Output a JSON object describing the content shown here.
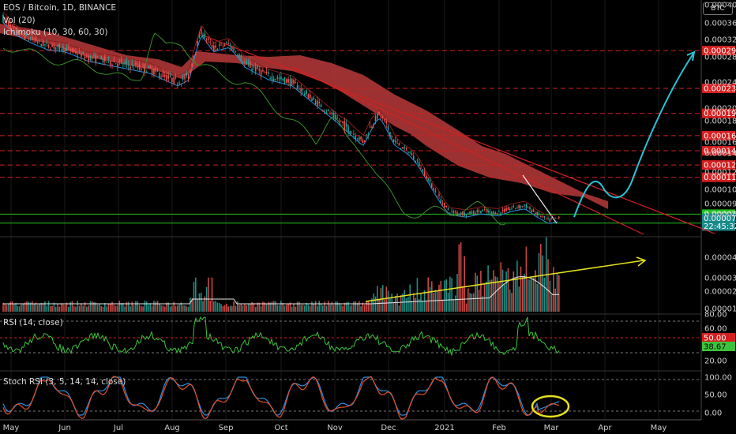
{
  "header": {
    "title": "EOS / Bitcoin, 1D, BINANCE",
    "vol_label": "Vol (20)",
    "ichimoku_label": "Ichimoku (10, 30, 60, 30)",
    "rsi_label": "RSI (14, close)",
    "stoch_label": "Stoch RSI (3, 5, 14, 14, close)",
    "currency_badge": "BTC"
  },
  "price_axis": {
    "ticks": [
      "0.0004000",
      "0.0003600",
      "0.0003200",
      "0.0002800",
      "0.0002400",
      "0.0002000",
      "0.0001800",
      "0.0001600",
      "0.0001400",
      "0.0001200",
      "0.0001000",
      "0.0000900",
      "0.0000800"
    ],
    "ylim": [
      7e-05,
      0.0004
    ]
  },
  "levels": [
    {
      "value": "0.0002944",
      "color": "#d42020"
    },
    {
      "value": "0.0002303",
      "color": "#d42020"
    },
    {
      "value": "0.0001916",
      "color": "#d42020"
    },
    {
      "value": "0.0001660",
      "color": "#d42020"
    },
    {
      "value": "0.0001442",
      "color": "#d42020"
    },
    {
      "value": "0.0001274",
      "color": "#d42020"
    },
    {
      "value": "0.0001139",
      "color": "#d42020"
    },
    {
      "value": "0.0000797",
      "color": "#1fc41f"
    },
    {
      "value": "0.0000716",
      "color": "#1fc41f"
    }
  ],
  "last_price": {
    "value": "0.0000761",
    "countdown": "22:45:32"
  },
  "volume_axis": {
    "ticks": [
      "0.0000450",
      "0.0000330",
      "0.0000230",
      "0.0000140"
    ]
  },
  "rsi_axis": {
    "ticks": [
      "80.00",
      "60.00",
      "20.00"
    ],
    "upper": "50.00",
    "value": "38.67"
  },
  "stoch_axis": {
    "ticks": [
      "100.00",
      "50.00",
      "0.00"
    ]
  },
  "time_axis": [
    "May",
    "Jun",
    "Jul",
    "Aug",
    "Sep",
    "Oct",
    "Nov",
    "Dec",
    "2021",
    "Feb",
    "Mar",
    "Apr",
    "May"
  ],
  "chart_data": [
    {
      "type": "candlestick",
      "title": "EOS / Bitcoin, 1D, BINANCE",
      "x_range": [
        "May 2020",
        "Mar 2021"
      ],
      "approx_close": [
        {
          "x": "May",
          "y": 0.00037
        },
        {
          "x": "Jun",
          "y": 0.0003
        },
        {
          "x": "Jul",
          "y": 0.00026
        },
        {
          "x": "Aug",
          "y": 0.00024
        },
        {
          "x": "Aug (mid)",
          "y": 0.00033
        },
        {
          "x": "Sep",
          "y": 0.00028
        },
        {
          "x": "Oct",
          "y": 0.00024
        },
        {
          "x": "Nov",
          "y": 0.00016
        },
        {
          "x": "Dec",
          "y": 0.00013
        },
        {
          "x": "2021",
          "y": 8e-05
        },
        {
          "x": "Feb",
          "y": 8e-05
        },
        {
          "x": "Mar",
          "y": 7.61e-05
        }
      ],
      "indicators": [
        "Ichimoku (10, 30, 60, 30)"
      ]
    },
    {
      "type": "bar",
      "title": "Vol (20)"
    },
    {
      "type": "line",
      "title": "RSI (14, close)",
      "last": 38.67,
      "ylim": [
        0,
        100
      ]
    },
    {
      "type": "line",
      "title": "Stoch RSI (3, 5, 14, 14, close)",
      "ylim": [
        0,
        100
      ]
    }
  ]
}
